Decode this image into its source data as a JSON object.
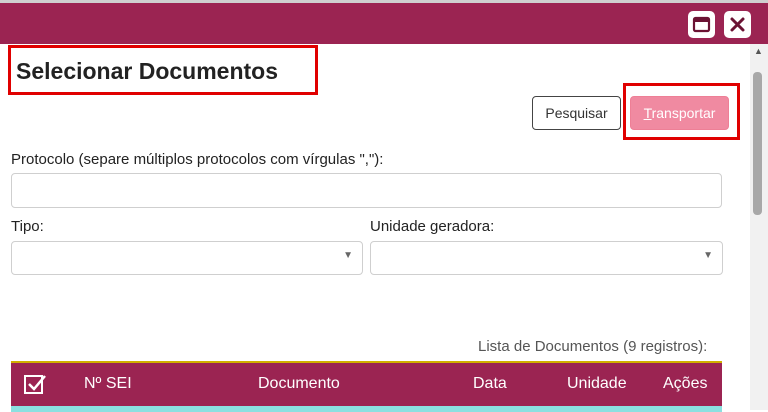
{
  "window": {
    "maximize_icon": "window-maximize-icon",
    "close_icon": "close-icon"
  },
  "page": {
    "title": "Selecionar Documentos"
  },
  "toolbar": {
    "pesquisar_label": "Pesquisar",
    "transportar_label": "Transportar"
  },
  "form": {
    "protocolo_label": "Protocolo (separe múltiplos protocolos com vírgulas \",\"):",
    "protocolo_value": "",
    "tipo_label": "Tipo:",
    "tipo_value": "",
    "unidade_label": "Unidade geradora:",
    "unidade_value": ""
  },
  "list": {
    "caption": "Lista de Documentos (9 registros):",
    "columns": [
      "Nº SEI",
      "Documento",
      "Data",
      "Unidade",
      "Ações"
    ]
  },
  "colors": {
    "header_bg": "#9b2452",
    "transportar_bg": "#f08aa1",
    "highlight_border": "#e00000",
    "selected_row": "#8be0e0"
  }
}
